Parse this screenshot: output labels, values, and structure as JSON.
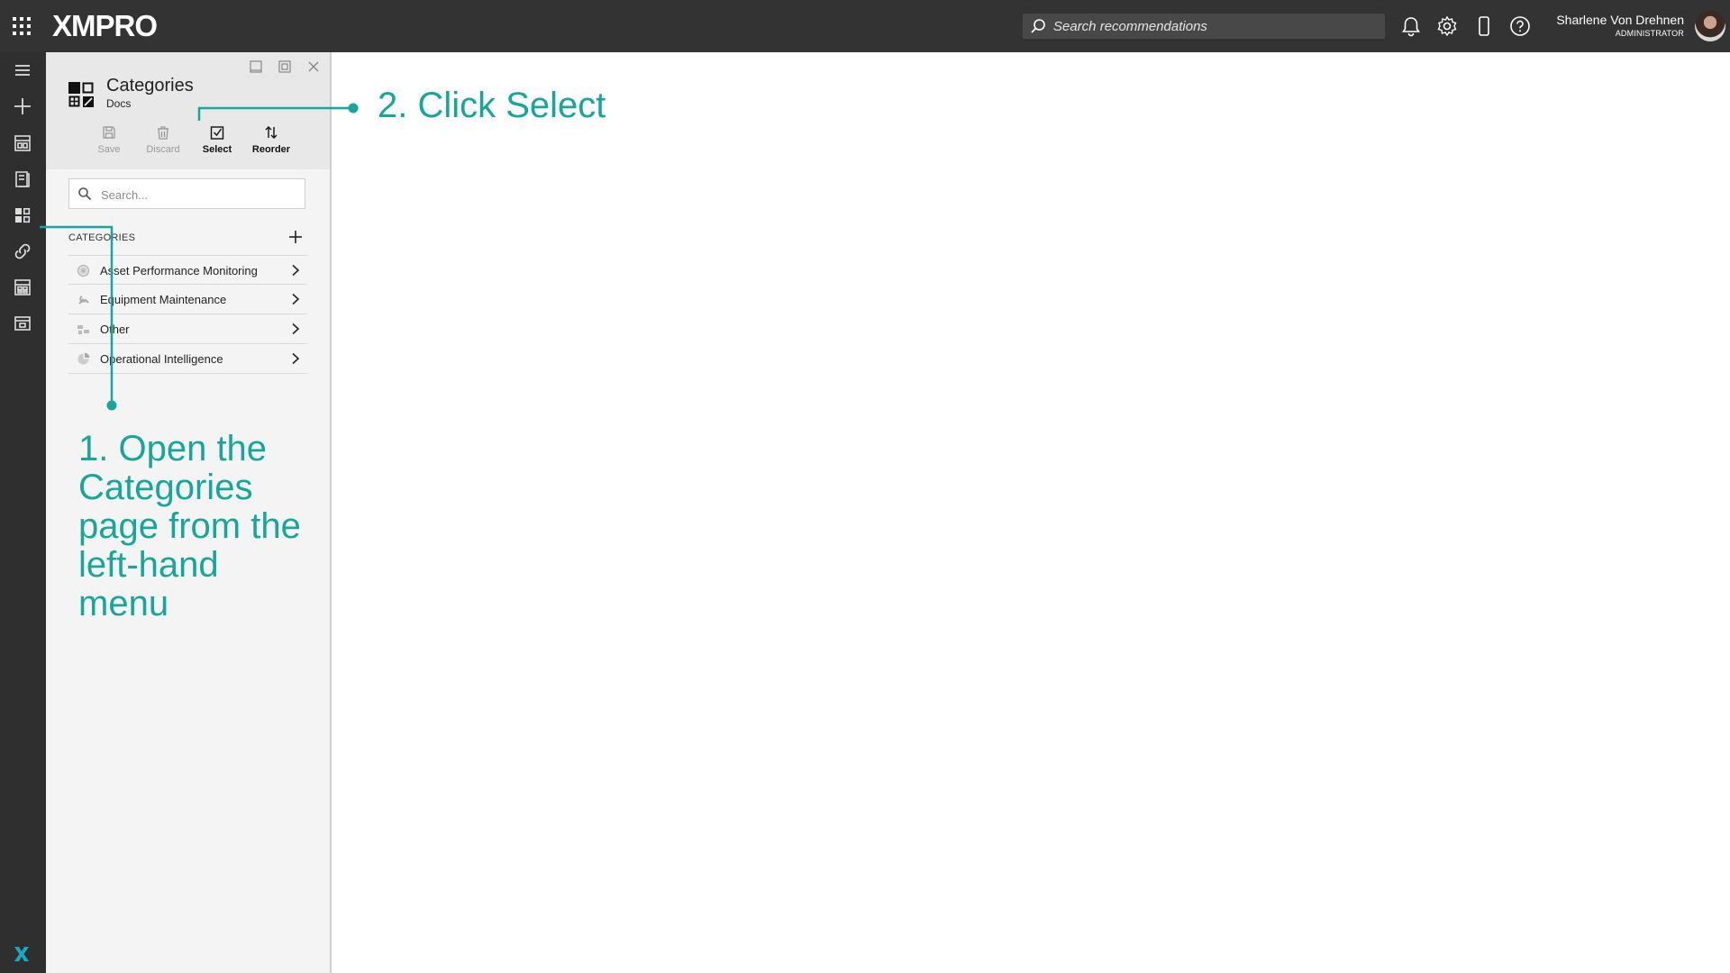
{
  "topbar": {
    "logo_text": "XMPRO",
    "search_placeholder": "Search recommendations",
    "user_name": "Sharlene Von Drehnen",
    "user_role": "ADMINISTRATOR",
    "icons": [
      "apps-grid-icon",
      "search-icon",
      "bell-icon",
      "gear-icon",
      "mobile-icon",
      "help-icon"
    ]
  },
  "rail": {
    "items": [
      "menu-icon",
      "plus-icon",
      "dashboard-icon",
      "book-icon",
      "categories-icon",
      "link-icon",
      "apps-icon",
      "layout-icon"
    ],
    "bottom_logo": "xmpro-x-icon"
  },
  "panel": {
    "title": "Categories",
    "subtitle": "Docs",
    "toolbar": {
      "save": "Save",
      "discard": "Discard",
      "select": "Select",
      "reorder": "Reorder"
    },
    "search_placeholder": "Search...",
    "section_header": "CATEGORIES",
    "categories": [
      {
        "label": "Asset Performance Monitoring"
      },
      {
        "label": "Equipment Maintenance"
      },
      {
        "label": "Other"
      },
      {
        "label": "Operational Intelligence"
      }
    ]
  },
  "annotations": {
    "step1": "1. Open the Categories page from the left-hand menu",
    "step2": "2. Click Select",
    "color": "#16a69a"
  },
  "colors": {
    "topbar": "#333333",
    "rail": "#2f2f2f",
    "accent": "#1aa8c7",
    "annotation": "#16a69a"
  }
}
